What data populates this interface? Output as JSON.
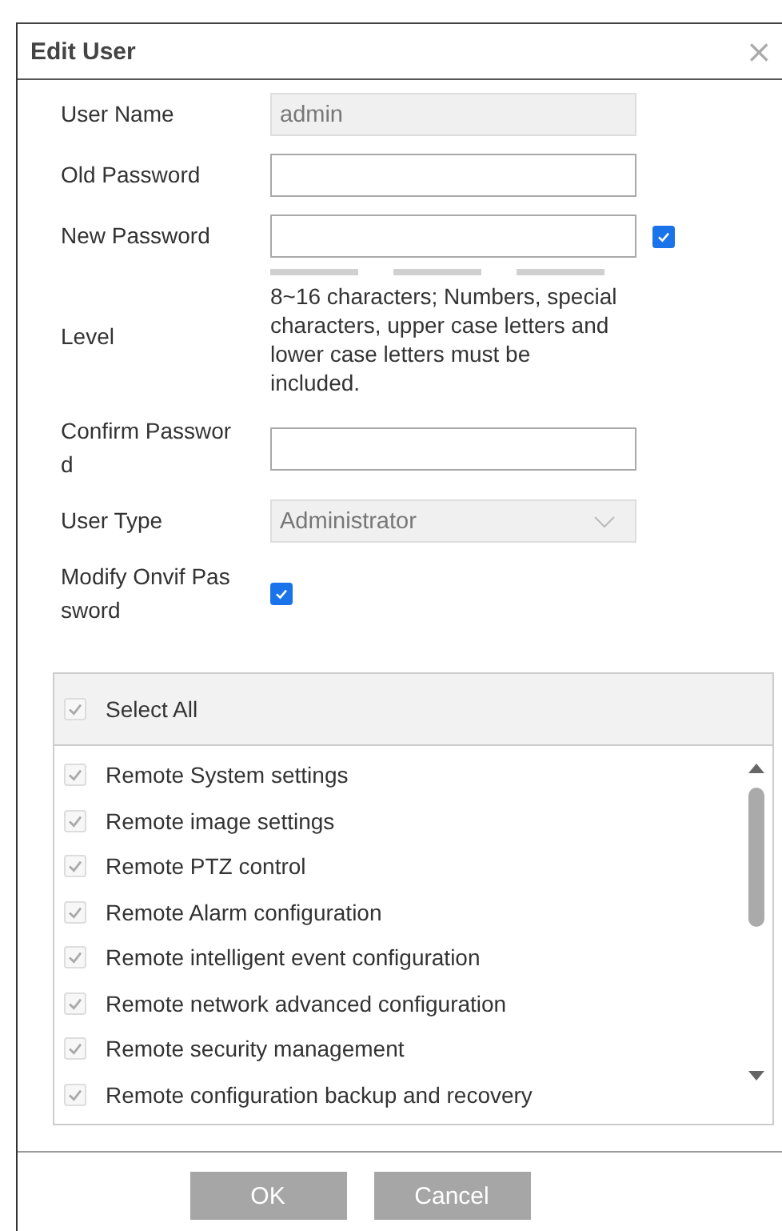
{
  "dialog": {
    "title": "Edit User",
    "close": "×"
  },
  "form": [
    {
      "kind": "text",
      "label": "User Name",
      "value": "admin",
      "disabled": true
    },
    {
      "kind": "password",
      "label": "Old Password"
    },
    {
      "kind": "password-toggle",
      "label": "New Password",
      "checked": true
    },
    {
      "kind": "strength",
      "label": "Level",
      "hint": "8~16 characters; Numbers, special characters, upper case letters and lower case letters must be included."
    },
    {
      "kind": "password",
      "label": "Confirm Password"
    },
    {
      "kind": "select",
      "label": "User Type",
      "value": "Administrator",
      "disabled": true
    },
    {
      "kind": "checkbox",
      "label": "Modify Onvif Password",
      "checked": true
    }
  ],
  "permissions": {
    "select_all": {
      "label": "Select All",
      "checked": true,
      "disabled": true
    },
    "items": [
      {
        "label": "Remote System settings",
        "checked": true,
        "disabled": true
      },
      {
        "label": "Remote image settings",
        "checked": true,
        "disabled": true
      },
      {
        "label": "Remote PTZ control",
        "checked": true,
        "disabled": true
      },
      {
        "label": "Remote Alarm configuration",
        "checked": true,
        "disabled": true
      },
      {
        "label": "Remote intelligent event configuration",
        "checked": true,
        "disabled": true
      },
      {
        "label": "Remote network advanced configuration",
        "checked": true,
        "disabled": true
      },
      {
        "label": "Remote security management",
        "checked": true,
        "disabled": true
      },
      {
        "label": "Remote configuration backup and recovery",
        "checked": true,
        "disabled": true
      }
    ]
  },
  "buttons": [
    "OK",
    "Cancel"
  ]
}
